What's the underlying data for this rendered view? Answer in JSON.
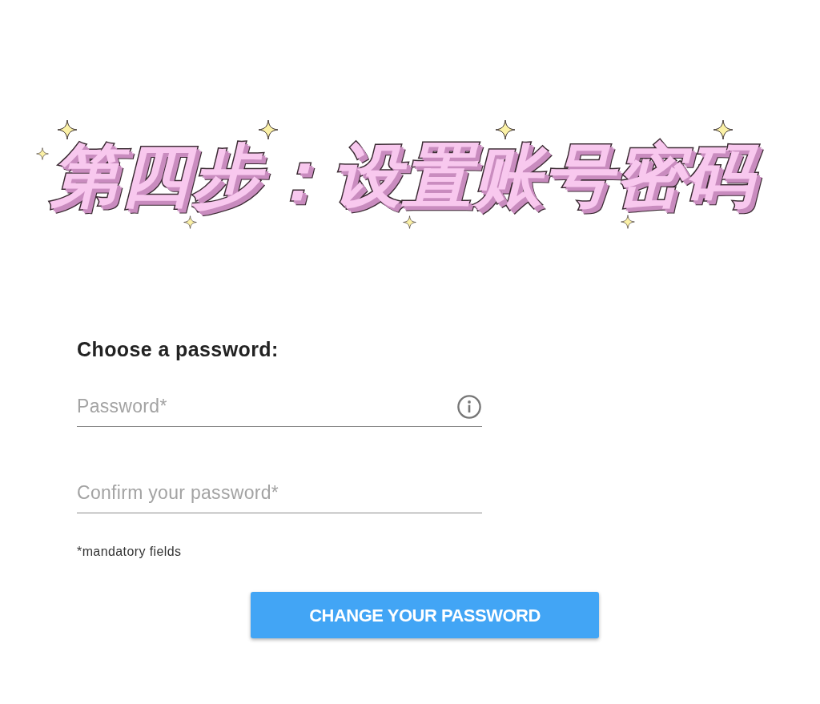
{
  "title": {
    "text": "第四步：设置账号密码"
  },
  "form": {
    "heading": "Choose a password:",
    "fields": [
      {
        "placeholder": "Password*",
        "info": true
      },
      {
        "placeholder": "Confirm your password*",
        "info": false
      }
    ],
    "note": "*mandatory fields",
    "button": "CHANGE YOUR PASSWORD"
  }
}
